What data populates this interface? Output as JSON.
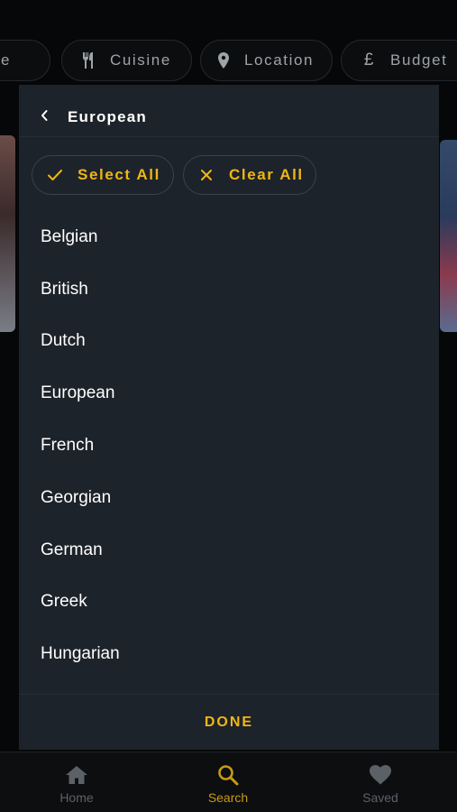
{
  "filters": [
    {
      "label": "e",
      "icon": "generic-icon"
    },
    {
      "label": "Cuisine",
      "icon": "fork-knife-icon"
    },
    {
      "label": "Location",
      "icon": "map-pin-icon"
    },
    {
      "label": "Budget",
      "icon": "pound-icon",
      "icon_glyph": "£"
    }
  ],
  "panel": {
    "title": "European",
    "select_all": "Select All",
    "clear_all": "Clear All",
    "items": [
      "Belgian",
      "British",
      "Dutch",
      "European",
      "French",
      "Georgian",
      "German",
      "Greek",
      "Hungarian"
    ],
    "done": "DONE"
  },
  "tabs": {
    "home": "Home",
    "search": "Search",
    "saved": "Saved",
    "active": "search"
  },
  "colors": {
    "accent": "#f0b615",
    "panel_bg": "#1d232a",
    "tab_inactive": "#5c6167"
  }
}
